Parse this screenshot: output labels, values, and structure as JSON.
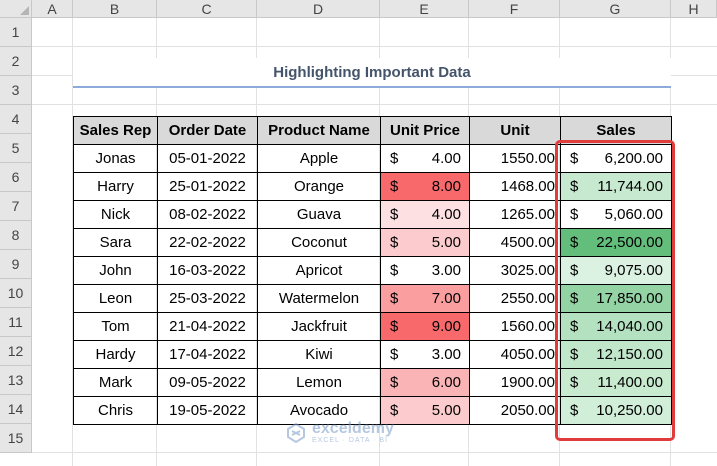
{
  "sheet": {
    "columns": [
      "A",
      "B",
      "C",
      "D",
      "E",
      "F",
      "G",
      "H"
    ],
    "rows": [
      "1",
      "2",
      "3",
      "4",
      "5",
      "6",
      "7",
      "8",
      "9",
      "10",
      "11",
      "12",
      "13",
      "14",
      "15"
    ]
  },
  "title": "Highlighting Important Data",
  "table": {
    "headers": [
      "Sales Rep",
      "Order Date",
      "Product Name",
      "Unit Price",
      "Unit",
      "Sales"
    ],
    "currency_symbol": "$",
    "rows": [
      {
        "rep": "Jonas",
        "date": "05-01-2022",
        "product": "Apple",
        "price": "4.00",
        "unit": "1550.00",
        "sales": "6,200.00",
        "price_fill": "#ffffff",
        "sales_fill": "#ffffff"
      },
      {
        "rep": "Harry",
        "date": "25-01-2022",
        "product": "Orange",
        "price": "8.00",
        "unit": "1468.00",
        "sales": "11,744.00",
        "price_fill": "#f8696b",
        "sales_fill": "#c6e9cf"
      },
      {
        "rep": "Nick",
        "date": "08-02-2022",
        "product": "Guava",
        "price": "4.00",
        "unit": "1265.00",
        "sales": "5,060.00",
        "price_fill": "#fde0e2",
        "sales_fill": "#ffffff"
      },
      {
        "rep": "Sara",
        "date": "22-02-2022",
        "product": "Coconut",
        "price": "5.00",
        "unit": "4500.00",
        "sales": "22,500.00",
        "price_fill": "#fccbcd",
        "sales_fill": "#63be7b"
      },
      {
        "rep": "John",
        "date": "16-03-2022",
        "product": "Apricot",
        "price": "3.00",
        "unit": "3025.00",
        "sales": "9,075.00",
        "price_fill": "#ffffff",
        "sales_fill": "#dbf1e1"
      },
      {
        "rep": "Leon",
        "date": "25-03-2022",
        "product": "Watermelon",
        "price": "7.00",
        "unit": "2550.00",
        "sales": "17,850.00",
        "price_fill": "#fa9ea0",
        "sales_fill": "#93d3a4"
      },
      {
        "rep": "Tom",
        "date": "21-04-2022",
        "product": "Jackfruit",
        "price": "9.00",
        "unit": "1560.00",
        "sales": "14,040.00",
        "price_fill": "#f8696b",
        "sales_fill": "#b4e2c1"
      },
      {
        "rep": "Hardy",
        "date": "17-04-2022",
        "product": "Kiwi",
        "price": "3.00",
        "unit": "4050.00",
        "sales": "12,150.00",
        "price_fill": "#ffffff",
        "sales_fill": "#c1e7cb"
      },
      {
        "rep": "Mark",
        "date": "09-05-2022",
        "product": "Lemon",
        "price": "6.00",
        "unit": "1900.00",
        "sales": "11,400.00",
        "price_fill": "#fbb4b6",
        "sales_fill": "#c8eacf"
      },
      {
        "rep": "Chris",
        "date": "19-05-2022",
        "product": "Avocado",
        "price": "5.00",
        "unit": "2050.00",
        "sales": "10,250.00",
        "price_fill": "#fccbcd",
        "sales_fill": "#d1eed9"
      }
    ]
  },
  "highlight_color": "#e03c3c",
  "watermark": {
    "name": "exceldemy",
    "tagline": "EXCEL · DATA · BI"
  }
}
